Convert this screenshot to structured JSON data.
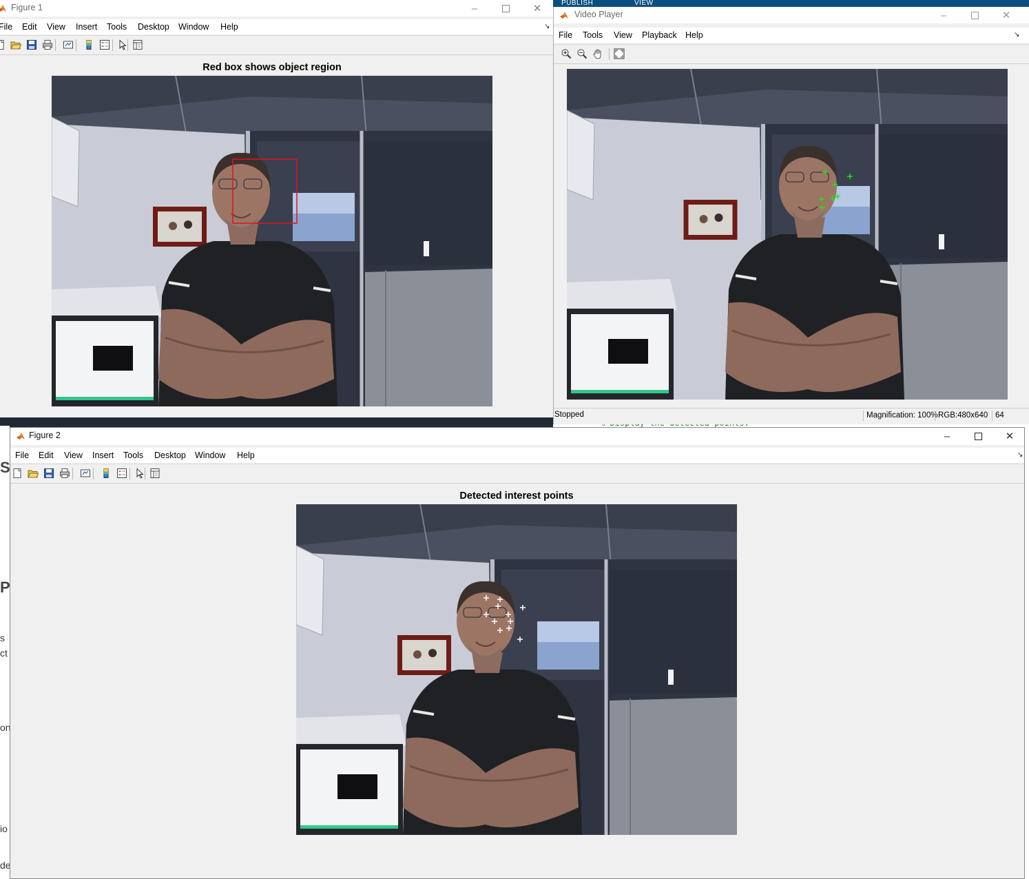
{
  "background": {
    "tabs": [
      "PUBLISH",
      "VIEW"
    ],
    "code_line": "% Display the detected points."
  },
  "figure1": {
    "window_title": "Figure 1",
    "menu": [
      "File",
      "Edit",
      "View",
      "Insert",
      "Tools",
      "Desktop",
      "Window",
      "Help"
    ],
    "axes_title": "Red box shows object region",
    "box_color": "#e0141e"
  },
  "video_player": {
    "window_title": "Video Player",
    "menu": [
      "File",
      "Tools",
      "View",
      "Playback",
      "Help"
    ],
    "status": "Stopped",
    "magnification": "Magnification: 100%",
    "image_info": "RGB:480x640",
    "frame": "64",
    "point_color": "#22e022"
  },
  "figure2": {
    "window_title": "Figure 2",
    "menu": [
      "File",
      "Edit",
      "View",
      "Insert",
      "Tools",
      "Desktop",
      "Window",
      "Help"
    ],
    "axes_title": "Detected interest points",
    "point_color": "#ffffff"
  },
  "icons": {
    "window_controls": [
      "minimize-icon",
      "maximize-icon",
      "close-icon"
    ],
    "figure_toolbar": [
      "new-figure-icon",
      "open-file-icon",
      "save-icon",
      "print-icon",
      "link-plot-icon",
      "insert-colorbar-icon",
      "insert-legend-icon",
      "edit-plot-icon",
      "property-inspector-icon"
    ],
    "player_toolbar": [
      "zoom-in-icon",
      "zoom-out-icon",
      "pan-icon",
      "fit-to-window-icon"
    ]
  }
}
